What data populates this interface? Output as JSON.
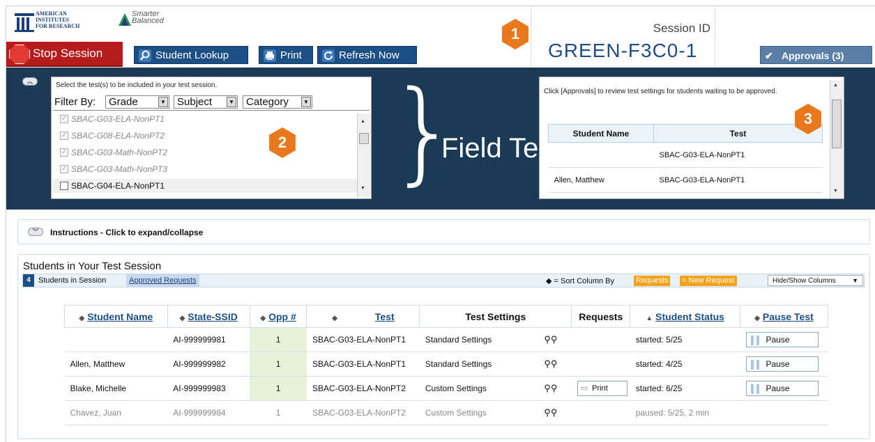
{
  "header": {
    "logo_air": "AMERICAN\nINSTITUTES\nFOR RESEARCH",
    "logo_sb": "Smarter\nBalanced",
    "session_label": "Session ID",
    "session_id": "GREEN-F3C0-1"
  },
  "toolbar": {
    "stop": "Stop Session",
    "lookup": "Student Lookup",
    "print": "Print",
    "refresh": "Refresh Now",
    "approvals": "Approvals (3)"
  },
  "tests_panel": {
    "instruction": "Select the test(s) to be included in your test session.",
    "filter_label": "Filter By:",
    "filters": [
      "Grade",
      "Subject",
      "Category"
    ],
    "items": [
      {
        "label": "SBAC-G03-ELA-NonPT1",
        "checked": true,
        "disabled": true
      },
      {
        "label": "SBAC-G08-ELA-NonPT2",
        "checked": true,
        "disabled": true
      },
      {
        "label": "SBAC-G03-Math-NonPT2",
        "checked": true,
        "disabled": true
      },
      {
        "label": "SBAC-G03-Math-NonPT3",
        "checked": true,
        "disabled": true
      },
      {
        "label": "SBAC-G04-ELA-NonPT1",
        "checked": false,
        "disabled": false
      }
    ]
  },
  "band": {
    "field_text": "Field Te"
  },
  "approvals_panel": {
    "text": "Click [Approvals] to review test settings for students waiting to be approved.",
    "headers": [
      "Student Name",
      "Test"
    ],
    "rows": [
      {
        "name": "",
        "test": "SBAC-G03-ELA-NonPT1"
      },
      {
        "name": "Allen, Matthew",
        "test": "SBAC-G03-ELA-NonPT1"
      }
    ]
  },
  "badges": [
    "1",
    "2",
    "3",
    "4"
  ],
  "instructions": {
    "label": "Instructions - Click to expand/collapse"
  },
  "students": {
    "title": "Students in Your Test Session",
    "count": "4",
    "in_session": "Students in Session",
    "approved_link": "Approved Requests",
    "sort_hint": "◆ = Sort Column By",
    "requests_tag": "Requests",
    "new_request_tag": "= New Request",
    "hide_show": "Hide/Show Columns",
    "columns": [
      "Student Name",
      "State-SSID",
      "Opp #",
      "Test",
      "Test Settings",
      "Requests",
      "Student Status",
      "Pause Test"
    ],
    "rows": [
      {
        "name": "",
        "ssid": "AI-999999981",
        "opp": "1",
        "test": "SBAC-G03-ELA-NonPT1",
        "settings": "Standard Settings",
        "request": "",
        "status": "started: 5/25",
        "pause": "Pause",
        "paused": false
      },
      {
        "name": "Allen, Matthew",
        "ssid": "AI-999999982",
        "opp": "1",
        "test": "SBAC-G03-ELA-NonPT1",
        "settings": "Standard Settings",
        "request": "",
        "status": "started: 4/25",
        "pause": "Pause",
        "paused": false
      },
      {
        "name": "Blake, Michelle",
        "ssid": "AI-999999983",
        "opp": "1",
        "test": "SBAC-G03-ELA-NonPT2",
        "settings": "Custom Settings",
        "request": "Print",
        "status": "started: 6/25",
        "pause": "Pause",
        "paused": false
      },
      {
        "name": "Chavez, Juan",
        "ssid": "AI-999999984",
        "opp": "1",
        "test": "SBAC-G03-ELA-NonPT2",
        "settings": "Custom Settings",
        "request": "",
        "status": "paused: 5/25, 2 min",
        "pause": "",
        "paused": true
      }
    ]
  },
  "colors": {
    "band": "#1b3a56",
    "accent": "#1c4f85",
    "stop": "#b71c1c",
    "badge": "#e9781c",
    "opp_bg": "#e6f3d9",
    "tag": "#f7a21b"
  }
}
